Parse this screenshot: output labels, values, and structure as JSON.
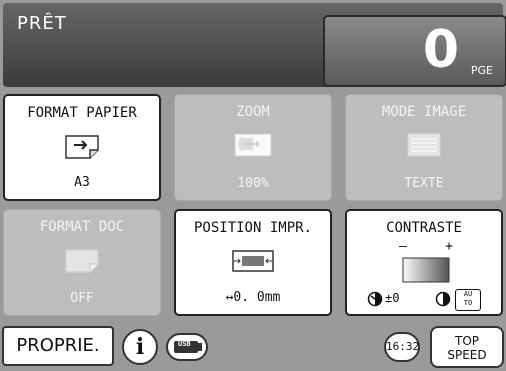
{
  "header": {
    "status": "PRÊT",
    "counter_value": "0",
    "counter_unit": "PGE"
  },
  "tiles": [
    {
      "title": "FORMAT PAPIER",
      "value": "A3",
      "icon": "paper-arrow-icon",
      "state": "active"
    },
    {
      "title": "ZOOM",
      "value": "100%",
      "icon": "zoom-icon",
      "state": "inactive"
    },
    {
      "title": "MODE IMAGE",
      "value": "TEXTE",
      "icon": "text-lines-icon",
      "state": "inactive"
    },
    {
      "title": "FORMAT DOC",
      "value": "OFF",
      "icon": "document-icon",
      "state": "inactive"
    },
    {
      "title": "POSITION IMPR.",
      "value": "↔0. 0mm",
      "icon": "print-position-icon",
      "state": "active"
    },
    {
      "title": "CONTRASTE",
      "value": "±0",
      "icon": "contrast-gradient-icon",
      "state": "active",
      "minus": "–",
      "plus": "+",
      "auto_label_top": "AU",
      "auto_label_bottom": "TO"
    }
  ],
  "bottom_bar": {
    "properties_label": "PROPRIE.",
    "info_label": "i",
    "usb_label": "USB",
    "time": "16:32",
    "speed_line1": "TOP",
    "speed_line2": "SPEED"
  },
  "colors": {
    "header_bg": "#4a4a4a",
    "panel_bg": "#9a9a9a",
    "inactive_tile": "#bdbdbd",
    "active_tile": "#ffffff"
  }
}
